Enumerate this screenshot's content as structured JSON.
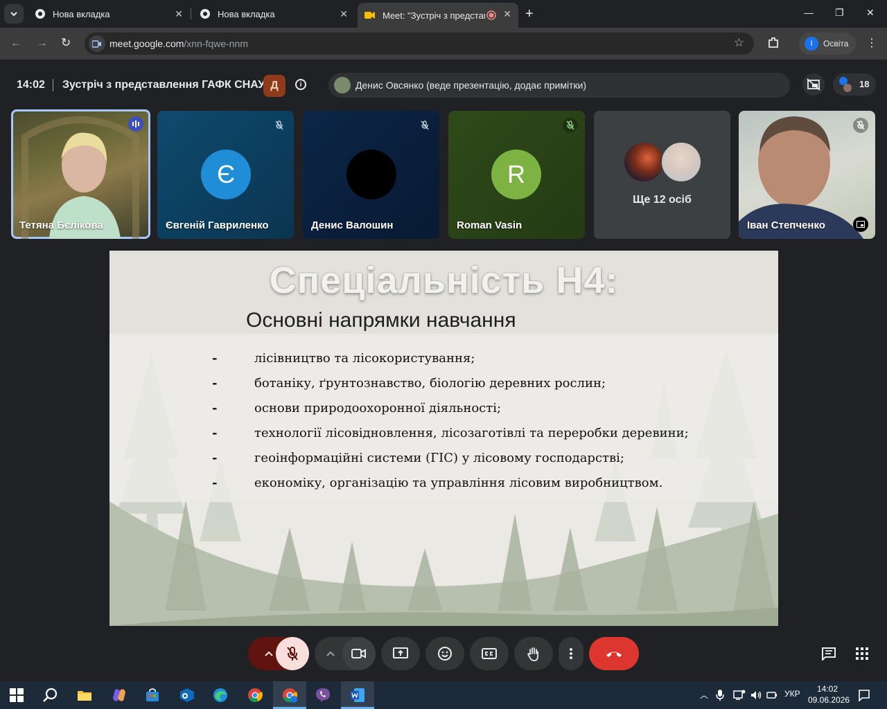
{
  "browser": {
    "tabs": [
      {
        "title": "Нова вкладка",
        "active": false
      },
      {
        "title": "Нова вкладка",
        "active": false
      },
      {
        "title": "Meet: \"Зустріч з представл",
        "active": true
      }
    ],
    "url_host": "meet.google.com",
    "url_path": "/xnn-fqwe-nnm",
    "profile_initial": "І",
    "profile_name": "Освіта"
  },
  "meet": {
    "time": "14:02",
    "meeting_title": "Зустріч з представлення ГАФК СНАУ",
    "logo_text": "Д",
    "presenter_text": "Денис Овсянко (веде презентацію, додає примітки)",
    "participant_count": "18"
  },
  "participants": [
    {
      "name": "Тетяна Бєлікова",
      "type": "video"
    },
    {
      "name": "Євгеній Гавриленко",
      "type": "avatar",
      "initial": "Є",
      "color": "#1f8ed6"
    },
    {
      "name": "Денис Валошин",
      "type": "avatar",
      "initial": "",
      "color": "#000000"
    },
    {
      "name": "Roman Vasin",
      "type": "avatar",
      "initial": "R",
      "color": "#7cb342"
    },
    {
      "name": "Ще 12 осіб",
      "type": "more"
    },
    {
      "name": "Іван Степченко",
      "type": "video"
    }
  ],
  "slide": {
    "title": "Спеціальність Н4:",
    "subtitle": "Основні напрямки навчання",
    "bullet_dash": "-",
    "bullets": [
      "лісівництво та лісокористування;",
      "ботаніку, ґрунтознавство, біологію деревних рослин;",
      "основи природоохоронної діяльності;",
      "технології лісовідновлення, лісозаготівлі та переробки деревини;",
      "геоінформаційні системи (ГІС) у лісовому господарстві;",
      "економіку, організацію та управління лісовим виробництвом."
    ]
  },
  "taskbar": {
    "tray_lang": "УКР",
    "clock_time": "14:02",
    "clock_date": "09.06.2026"
  },
  "colors": {
    "accent": "#a8c7fa",
    "leave_button": "#ea4335",
    "mic_off_bg": "#f9dedc",
    "mic_group_bg": "#601410"
  }
}
